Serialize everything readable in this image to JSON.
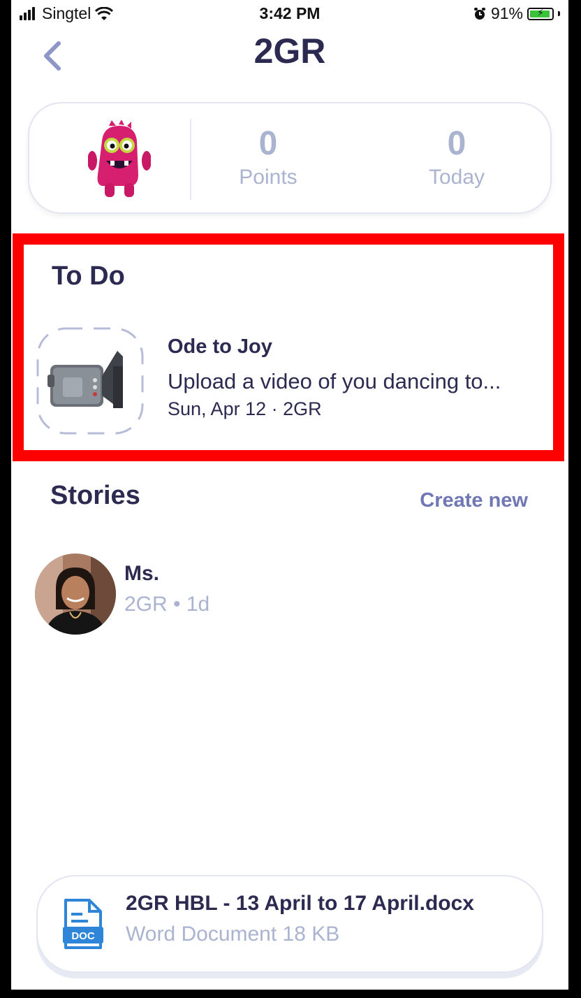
{
  "status_bar": {
    "carrier": "Singtel",
    "time": "3:42 PM",
    "battery": "91%",
    "battery_level": 0.91
  },
  "header": {
    "title": "2GR",
    "back_icon": "chevron-left-icon"
  },
  "summary": {
    "points_value": "0",
    "points_label": "Points",
    "today_value": "0",
    "today_label": "Today",
    "avatar_icon": "pink-monster-avatar"
  },
  "todo": {
    "heading": "To Do",
    "item": {
      "title": "Ode to Joy",
      "description": "Upload a video of you dancing to...",
      "meta": "Sun, Apr 12 · 2GR",
      "icon": "video-camera-icon"
    }
  },
  "stories": {
    "heading": "Stories",
    "create_label": "Create new",
    "post": {
      "author": "Ms.",
      "meta": "2GR • 1d"
    }
  },
  "attachment": {
    "file_name": "2GR HBL - 13 April to 17 April.docx",
    "file_meta": "Word Document 18 KB",
    "icon_label": "DOC"
  },
  "colors": {
    "text_dark": "#2c2a50",
    "text_muted": "#aab3d0",
    "accent": "#6f77b5",
    "highlight": "#ff0000"
  }
}
